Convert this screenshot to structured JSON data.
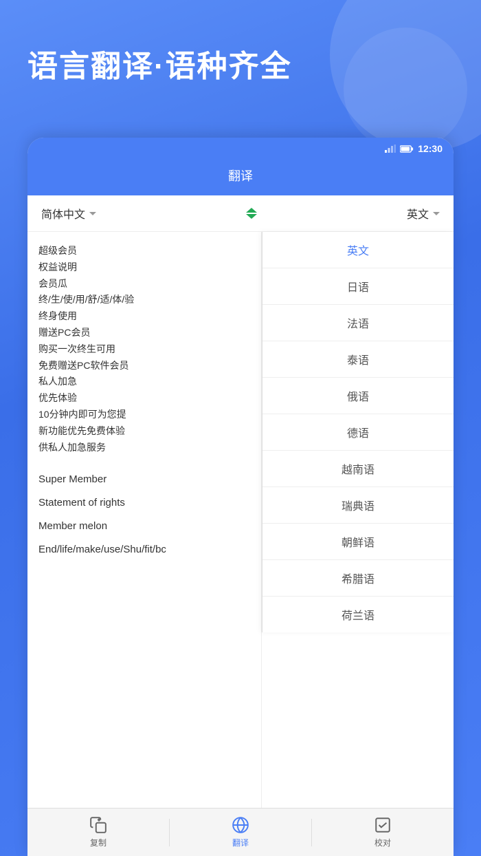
{
  "background": {
    "gradient_start": "#5b8ef5",
    "gradient_end": "#3a6ee8"
  },
  "header": {
    "tagline": "语言翻译·语种齐全"
  },
  "status_bar": {
    "time": "12:30",
    "signal_label": "signal",
    "battery_label": "battery"
  },
  "app_topbar": {
    "title": "翻译"
  },
  "lang_selector": {
    "source_lang": "简体中文",
    "target_lang": "英文",
    "swap_icon_label": "swap-languages"
  },
  "left_panel": {
    "chinese_lines": [
      "超级会员",
      "权益说明",
      "会员瓜",
      "终/生/使/用/舒/适/体/验",
      "终身使用",
      "赠送PC会员",
      "购买一次终生可用",
      "免费赠送PC软件会员",
      "私人加急",
      "优先体验",
      "10分钟内即可为您提",
      "新功能优先免费体验",
      "供私人加急服务"
    ],
    "translated_lines": [
      "Super Member",
      "Statement of rights",
      "Member melon",
      "End/life/make/use/Shu/fit/bc"
    ]
  },
  "right_panel": {
    "dropdown_items": [
      "英文",
      "日语",
      "法语",
      "泰语",
      "俄语",
      "德语",
      "越南语",
      "瑞典语",
      "朝鲜语",
      "希腊语",
      "荷兰语"
    ]
  },
  "tab_bar": {
    "items": [
      {
        "label": "复制",
        "icon": "copy",
        "active": false
      },
      {
        "label": "翻译",
        "icon": "translate",
        "active": true
      },
      {
        "label": "校对",
        "icon": "check",
        "active": false
      }
    ]
  }
}
